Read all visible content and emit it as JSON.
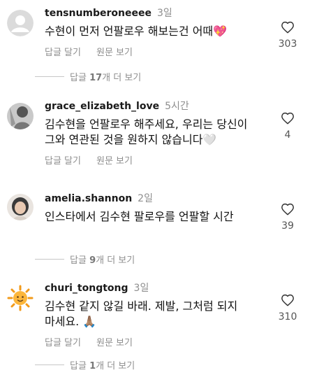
{
  "comments": [
    {
      "username": "tensnumberoneeee",
      "time": "3일",
      "text": "수현이 먼저 언팔로우 해보는건 어때💖",
      "reply_label": "답글 달기",
      "original_label": "원문 보기",
      "likes": "303",
      "view_replies": {
        "pre": "답글 ",
        "count": "17",
        "post": "개 더 보기"
      }
    },
    {
      "username": "grace_elizabeth_love",
      "time": "5시간",
      "text": "김수현을 언팔로우 해주세요, 우리는 당신이 그와 연관된 것을 원하지 않습니다🤍",
      "reply_label": "답글 달기",
      "original_label": "원문 보기",
      "likes": "4"
    },
    {
      "username": "amelia.shannon",
      "time": "2일",
      "text": "인스타에서 김수현 팔로우를 언팔할 시간",
      "likes": "39",
      "view_replies": {
        "pre": "답글 ",
        "count": "9",
        "post": "개 더 보기"
      }
    },
    {
      "username": "churi_tongtong",
      "time": "3일",
      "text": "김수현 같지 않길 바래. 제발, 그처럼 되지 마세요. 🙏🏽",
      "reply_label": "답글 달기",
      "original_label": "원문 보기",
      "likes": "310",
      "view_replies": {
        "pre": "답글 ",
        "count": "1",
        "post": "개 더 보기"
      }
    }
  ],
  "icons": {
    "like": "heart-outline-icon"
  },
  "colors": {
    "text": "#111111",
    "muted": "#8e8e8e",
    "divider": "#c7c7c7"
  }
}
